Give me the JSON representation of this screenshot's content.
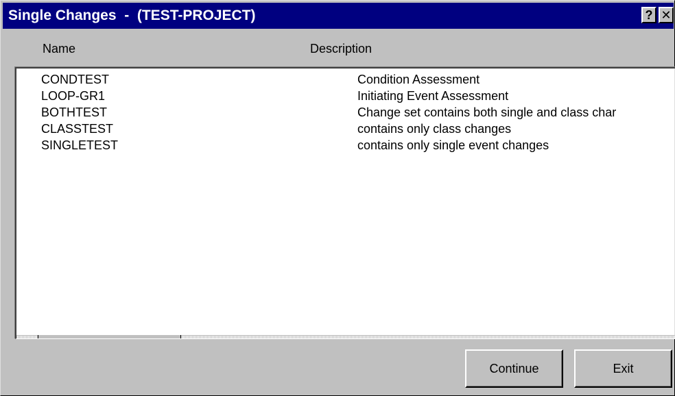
{
  "window": {
    "title": "Single Changes  -  (TEST-PROJECT)",
    "help_glyph": "?",
    "close_glyph": "✕"
  },
  "columns": {
    "name": "Name",
    "description": "Description"
  },
  "rows": [
    {
      "name": "CONDTEST",
      "description": "Condition Assessment"
    },
    {
      "name": "LOOP-GR1",
      "description": "Initiating Event Assessment"
    },
    {
      "name": "BOTHTEST",
      "description": "Change set contains both single and class char"
    },
    {
      "name": "CLASSTEST",
      "description": "contains only class changes"
    },
    {
      "name": "SINGLETEST",
      "description": "contains only single event changes"
    }
  ],
  "buttons": {
    "continue": "Continue",
    "exit": "Exit"
  },
  "colors": {
    "titlebar": "#000080",
    "face": "#c0c0c0"
  }
}
